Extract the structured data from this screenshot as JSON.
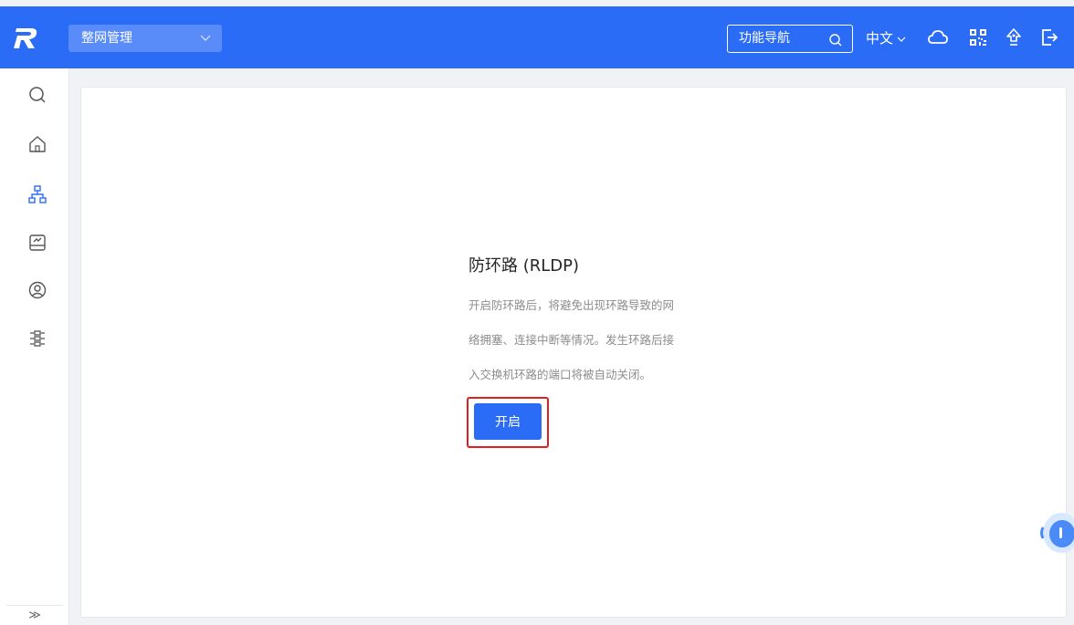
{
  "header": {
    "brand_logo": "R",
    "scope_select": {
      "value": "整网管理",
      "icon": "chevron-down-icon"
    },
    "nav_search": {
      "label": "功能导航",
      "icon": "search-icon"
    },
    "language": {
      "label": "中文",
      "icon": "chevron-down-icon"
    },
    "icons": [
      "cloud-icon",
      "qrcode-icon",
      "rocket-icon",
      "logout-icon"
    ]
  },
  "sidebar": {
    "items": [
      {
        "icon": "search-icon",
        "active": false
      },
      {
        "icon": "home-icon",
        "active": false
      },
      {
        "icon": "network-topology-icon",
        "active": true
      },
      {
        "icon": "device-icon",
        "active": false
      },
      {
        "icon": "user-icon",
        "active": false
      },
      {
        "icon": "settings-sliders-icon",
        "active": false
      }
    ],
    "expand_label": "≫"
  },
  "main": {
    "title": "防环路 (RLDP)",
    "description_lines": [
      "开启防环路后，将避免出现环路导致的网",
      "络拥塞、连接中断等情况。发生环路后接",
      "入交换机环路的端口将被自动关闭。"
    ],
    "enable_button": "开启"
  },
  "colors": {
    "primary": "#2b6cf6",
    "highlight_border": "#e02020",
    "sidebar_active": "#2b6cf6",
    "icon_gray": "#555555"
  }
}
